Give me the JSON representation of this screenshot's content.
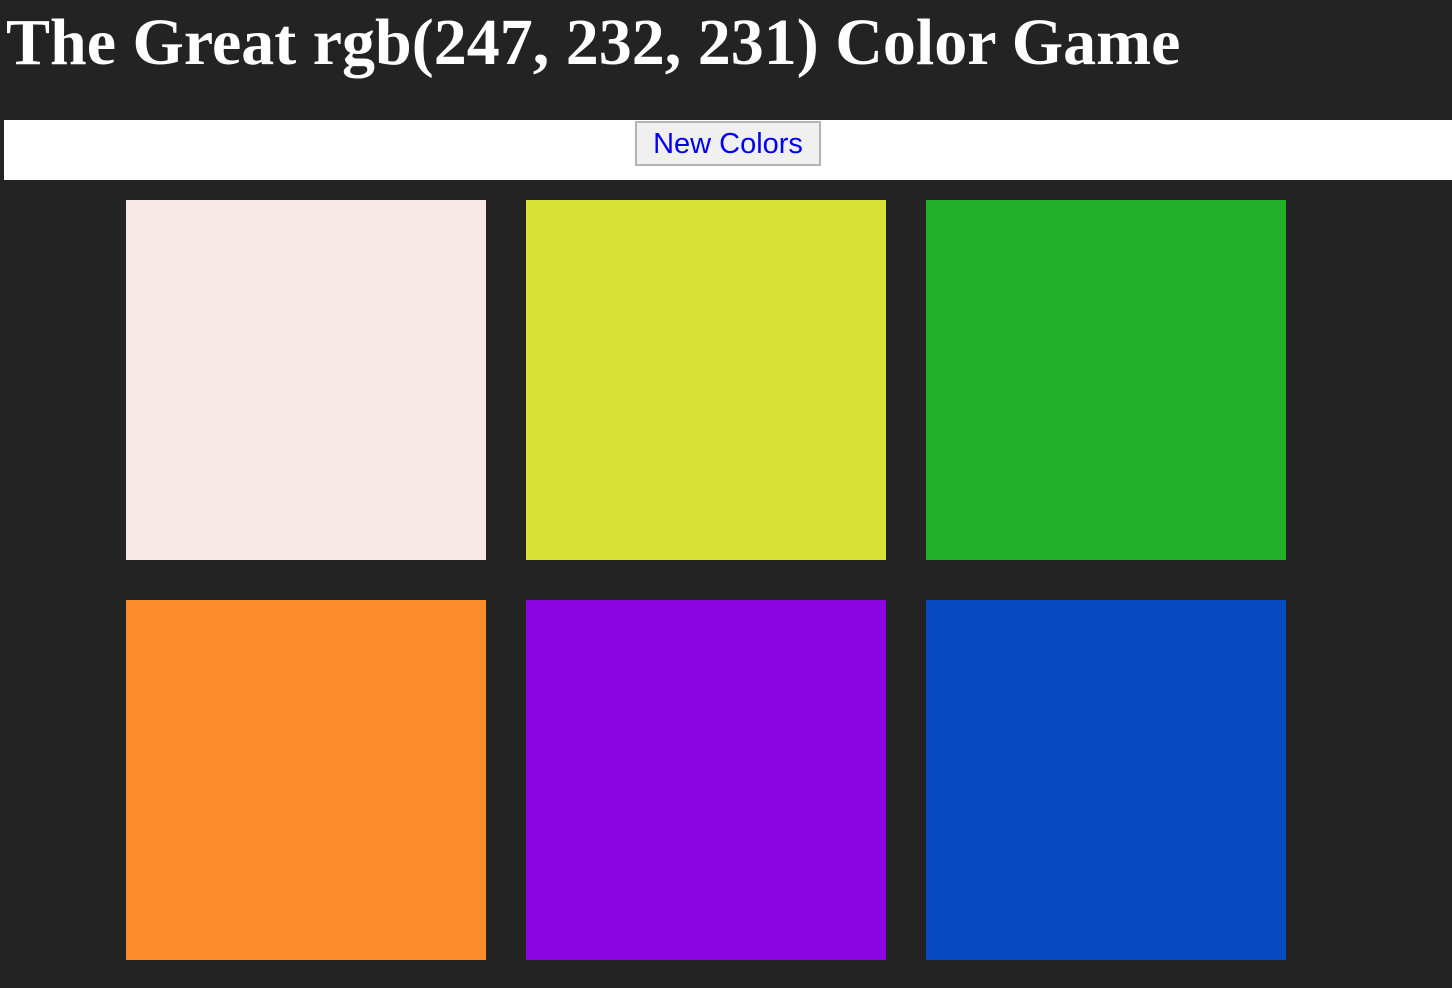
{
  "header": {
    "title": "The Great rgb(247, 232, 231) Color Game"
  },
  "toolbar": {
    "new_colors_label": "New Colors"
  },
  "theme": {
    "page_background": "#232323",
    "title_color": "#ffffff",
    "stripe_background": "#ffffff",
    "button_text_color": "#0000ee"
  },
  "squares": [
    {
      "color": "#f7e8e7"
    },
    {
      "color": "#d9e336"
    },
    {
      "color": "#22b029"
    },
    {
      "color": "#fb8e2b"
    },
    {
      "color": "#8c05e3"
    },
    {
      "color": "#0649c1"
    }
  ]
}
